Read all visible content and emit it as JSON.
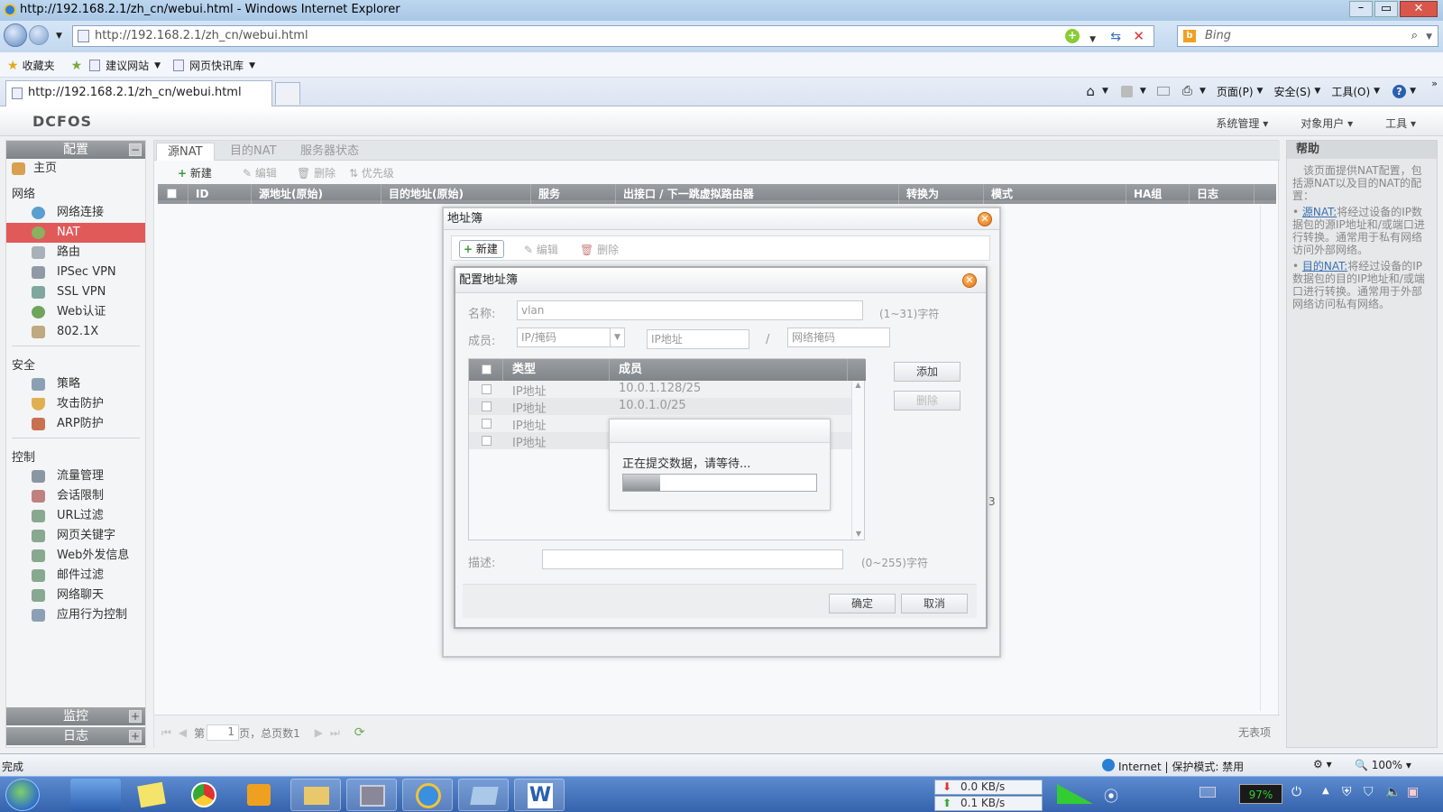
{
  "browser": {
    "title": "http://192.168.2.1/zh_cn/webui.html - Windows Internet Explorer",
    "address": "http://192.168.2.1/zh_cn/webui.html",
    "search_placeholder": "Bing",
    "favorites": "收藏夹",
    "suggested_sites": "建议网站",
    "web_slice": "网页快讯库",
    "tab_title": "http://192.168.2.1/zh_cn/webui.html",
    "commands": {
      "page": "页面(P)",
      "safety": "安全(S)",
      "tools": "工具(O)"
    }
  },
  "app": {
    "logo": "DCFOS",
    "menu": {
      "system": "系统管理",
      "object": "对象用户",
      "tools": "工具"
    }
  },
  "sidebar": {
    "header": "配置",
    "home": "主页",
    "sections": {
      "network": {
        "title": "网络",
        "items": [
          "网络连接",
          "NAT",
          "路由",
          "IPSec VPN",
          "SSL VPN",
          "Web认证",
          "802.1X"
        ]
      },
      "security": {
        "title": "安全",
        "items": [
          "策略",
          "攻击防护",
          "ARP防护"
        ]
      },
      "control": {
        "title": "控制",
        "items": [
          "流量管理",
          "会话限制",
          "URL过滤",
          "网页关键字",
          "Web外发信息",
          "邮件过滤",
          "网络聊天",
          "应用行为控制"
        ]
      }
    },
    "monitor": "监控",
    "log": "日志"
  },
  "main": {
    "tabs": [
      "源NAT",
      "目的NAT",
      "服务器状态"
    ],
    "toolbar": {
      "new": "新建",
      "edit": "编辑",
      "delete": "删除",
      "priority": "优先级"
    },
    "columns": [
      "ID",
      "源地址(原始)",
      "目的地址(原始)",
      "服务",
      "出接口 / 下一跳虚拟路由器",
      "转换为",
      "模式",
      "HA组",
      "日志"
    ],
    "pager": {
      "page_prefix": "第",
      "page": "1",
      "page_suffix": "页，总页数1",
      "empty": "无表项"
    }
  },
  "help": {
    "title": "帮助",
    "intro": "该页面提供NAT配置，包括源NAT以及目的NAT的配置：",
    "item1_link": "源NAT:",
    "item1_text": "将经过设备的IP数据包的源IP地址和/或端口进行转换。通常用于私有网络访问外部网络。",
    "item2_link": "目的NAT:",
    "item2_text": "将经过设备的IP数据包的目的IP地址和/或端口进行转换。通常用于外部网络访问私有网络。"
  },
  "address_book_dialog": {
    "title": "地址簿",
    "new": "新建",
    "edit": "编辑",
    "delete": "删除",
    "cut_off_text": "3"
  },
  "config_dialog": {
    "title": "配置地址簿",
    "name_label": "名称:",
    "name_value": "vlan",
    "name_hint": "(1~31)字符",
    "member_label": "成员:",
    "member_type": "IP/掩码",
    "ip_placeholder": "IP地址",
    "slash": "/",
    "mask_placeholder": "网络掩码",
    "add": "添加",
    "remove": "删除",
    "table_cols": [
      "类型",
      "成员"
    ],
    "rows": [
      {
        "type": "IP地址",
        "member": "10.0.1.128/25"
      },
      {
        "type": "IP地址",
        "member": "10.0.1.0/25"
      },
      {
        "type": "IP地址",
        "member": ""
      },
      {
        "type": "IP地址",
        "member": ""
      }
    ],
    "desc_label": "描述:",
    "desc_hint": "(0~255)字符",
    "ok": "确定",
    "cancel": "取消"
  },
  "progress": {
    "message": "正在提交数据，请等待...",
    "fraction": 0.19
  },
  "statusbar": {
    "left": "完成",
    "zone": "Internet | 保护模式: 禁用",
    "zoom": "100%"
  },
  "taskbar": {
    "download": "0.0 KB/s",
    "upload": "0.1 KB/s",
    "battery": "97%"
  }
}
